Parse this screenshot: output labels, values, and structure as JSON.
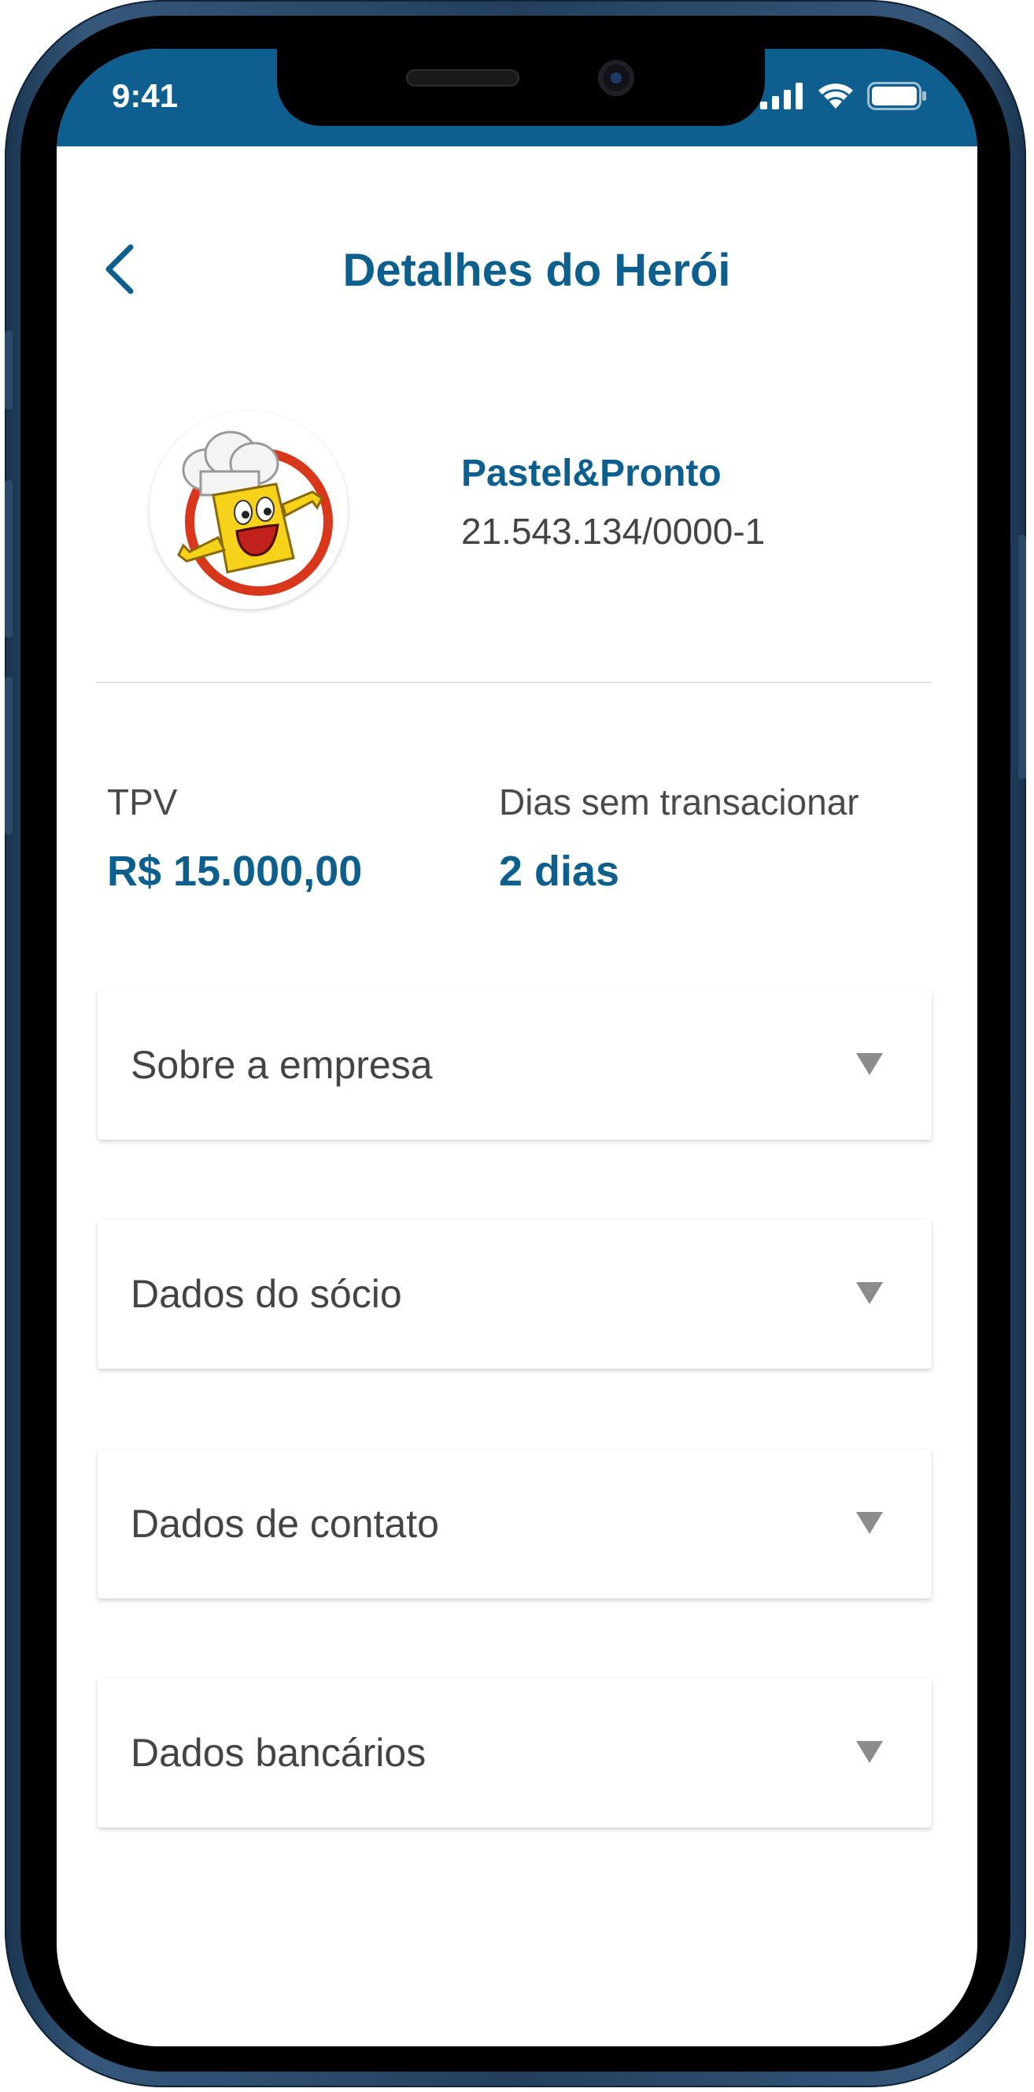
{
  "status_bar": {
    "time": "9:41",
    "icons": [
      "cellular-signal-icon",
      "wifi-icon",
      "battery-icon"
    ]
  },
  "header": {
    "title": "Detalhes do Herói",
    "back_icon": "chevron-left-icon"
  },
  "profile": {
    "name": "Pastel&Pronto",
    "cnpj": "21.543.134/0000-1",
    "avatar_icon": "pastel-chef-logo"
  },
  "metrics": {
    "tpv_label": "TPV",
    "tpv_value": "R$ 15.000,00",
    "days_label": "Dias sem transacionar",
    "days_value": "2 dias"
  },
  "sections": [
    {
      "label": "Sobre a empresa"
    },
    {
      "label": "Dados do sócio"
    },
    {
      "label": "Dados de contato"
    },
    {
      "label": "Dados bancários"
    }
  ],
  "colors": {
    "brand": "#0d5f8e",
    "status_bar": "#0e5e90",
    "text": "#444444",
    "arrow": "#8c8c8c"
  }
}
